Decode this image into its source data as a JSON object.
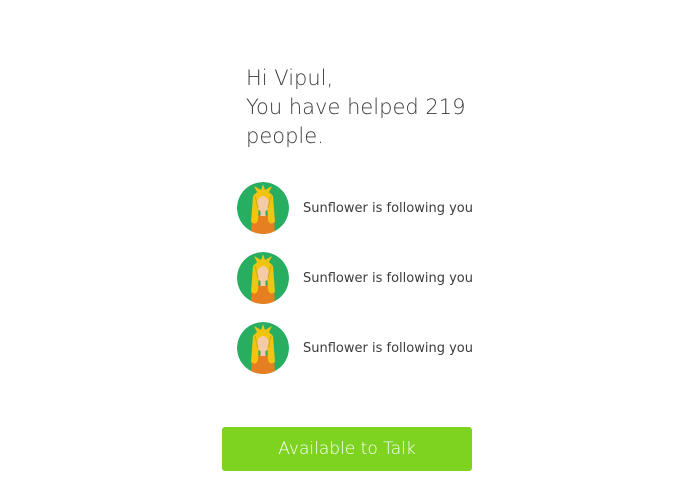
{
  "greeting": {
    "line1": "Hi Vipul,",
    "line2": "You have helped 219",
    "line3": "people."
  },
  "feed": {
    "items": [
      {
        "text": "Sunflower is following you",
        "avatar_icon": "sunflower-avatar-icon"
      },
      {
        "text": "Sunflower is following you",
        "avatar_icon": "sunflower-avatar-icon"
      },
      {
        "text": "Sunflower is following you",
        "avatar_icon": "sunflower-avatar-icon"
      }
    ]
  },
  "cta": {
    "label": "Available to Talk",
    "color": "#7ed321"
  },
  "colors": {
    "avatar_bg": "#27ae60",
    "hair": "#f1c40f",
    "skin": "#f5cba7",
    "shirt": "#e67e22"
  }
}
